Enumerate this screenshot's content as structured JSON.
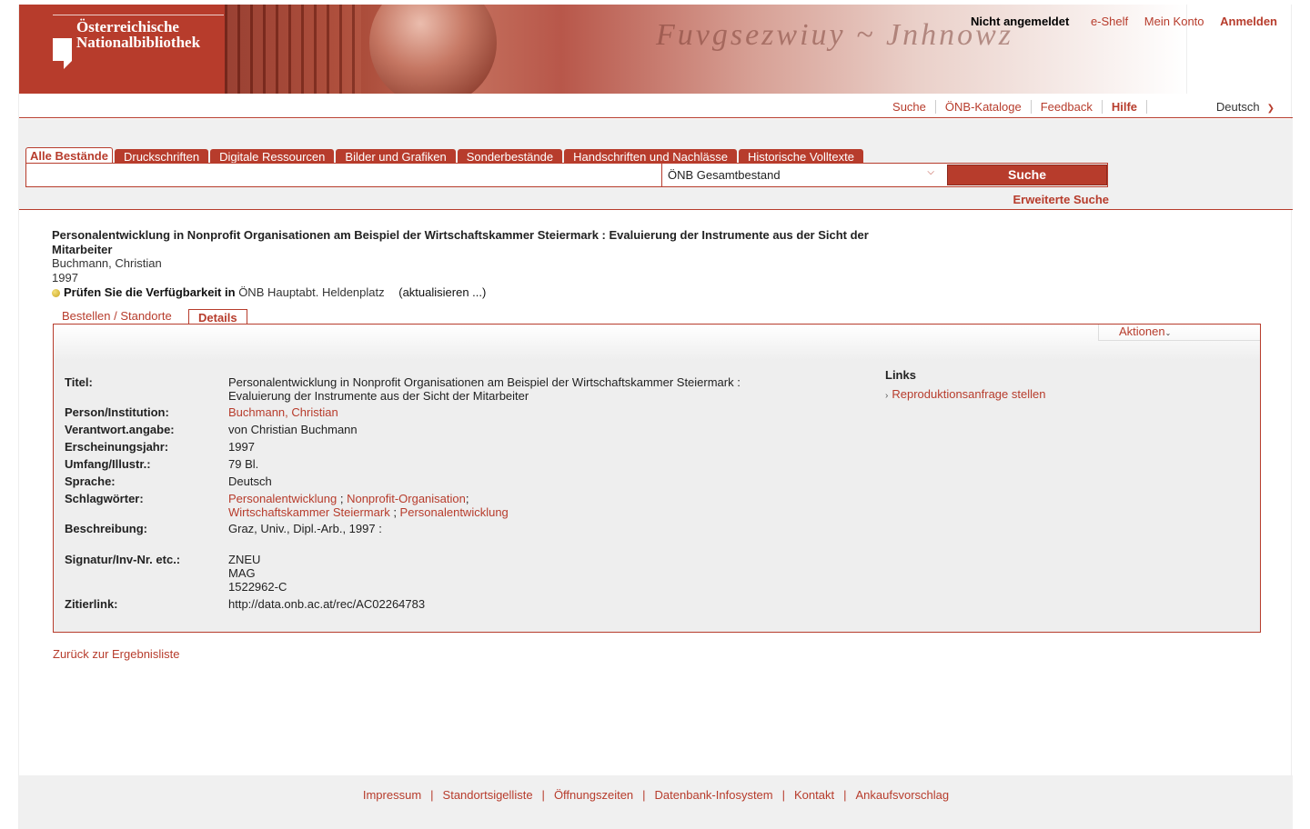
{
  "header": {
    "logo_line1": "Österreichische",
    "logo_line2": "Nationalbibliothek",
    "login_status": "Nicht angemeldet",
    "eshelf": "e-Shelf",
    "account": "Mein Konto",
    "login": "Anmelden"
  },
  "subnav": {
    "search": "Suche",
    "catalogs": "ÖNB-Kataloge",
    "feedback": "Feedback",
    "help": "Hilfe",
    "language": "Deutsch"
  },
  "search": {
    "tabs": [
      "Alle Bestände",
      "Druckschriften",
      "Digitale Ressourcen",
      "Bilder und Grafiken",
      "Sonderbestände",
      "Handschriften und Nachlässe",
      "Historische Volltexte"
    ],
    "query": "",
    "scope": "ÖNB Gesamtbestand",
    "button": "Suche",
    "advanced": "Erweiterte Suche"
  },
  "record": {
    "title": "Personalentwicklung in Nonprofit Organisationen am Beispiel der Wirtschaftskammer Steiermark : Evaluierung der Instrumente aus der Sicht der Mitarbeiter",
    "author": "Buchmann, Christian",
    "year": "1997",
    "availability_label": "Prüfen Sie die Verfügbarkeit in",
    "availability_location": "ÖNB Hauptabt. Heldenplatz",
    "update": "(aktualisieren ...)"
  },
  "detail_tabs": {
    "order": "Bestellen / Standorte",
    "details": "Details",
    "actions": "Aktionen"
  },
  "details": {
    "title_label": "Titel:",
    "title_value": "Personalentwicklung in Nonprofit Organisationen am Beispiel der Wirtschaftskammer Steiermark : Evaluierung der Instrumente aus der Sicht der Mitarbeiter",
    "person_label": "Person/Institution:",
    "person_value": "Buchmann, Christian",
    "resp_label": "Verantwort.angabe:",
    "resp_value": "von Christian Buchmann",
    "year_label": "Erscheinungsjahr:",
    "year_value": "1997",
    "extent_label": "Umfang/Illustr.:",
    "extent_value": "79 Bl.",
    "lang_label": "Sprache:",
    "lang_value": "Deutsch",
    "subjects_label": "Schlagwörter:",
    "subjects": [
      "Personalentwicklung",
      "Nonprofit-Organisation",
      "Wirtschaftskammer Steiermark",
      "Personalentwicklung"
    ],
    "desc_label": "Beschreibung:",
    "desc_value": "Graz, Univ., Dipl.-Arb., 1997 :",
    "sig_label": "Signatur/Inv-Nr. etc.:",
    "sig_line1": "ZNEU",
    "sig_line2": "MAG",
    "sig_line3": "1522962-C",
    "cite_label": "Zitierlink:",
    "cite_value": "http://data.onb.ac.at/rec/AC02264783"
  },
  "links": {
    "heading": "Links",
    "item": "Reproduktionsanfrage stellen"
  },
  "back": "Zurück zur Ergebnisliste",
  "footer": [
    "Impressum",
    "Standortsigelliste",
    "Öffnungszeiten",
    "Datenbank-Infosystem",
    "Kontakt",
    "Ankaufsvorschlag"
  ],
  "colors": {
    "accent": "#b73c2c",
    "panel": "#eeeeee"
  }
}
